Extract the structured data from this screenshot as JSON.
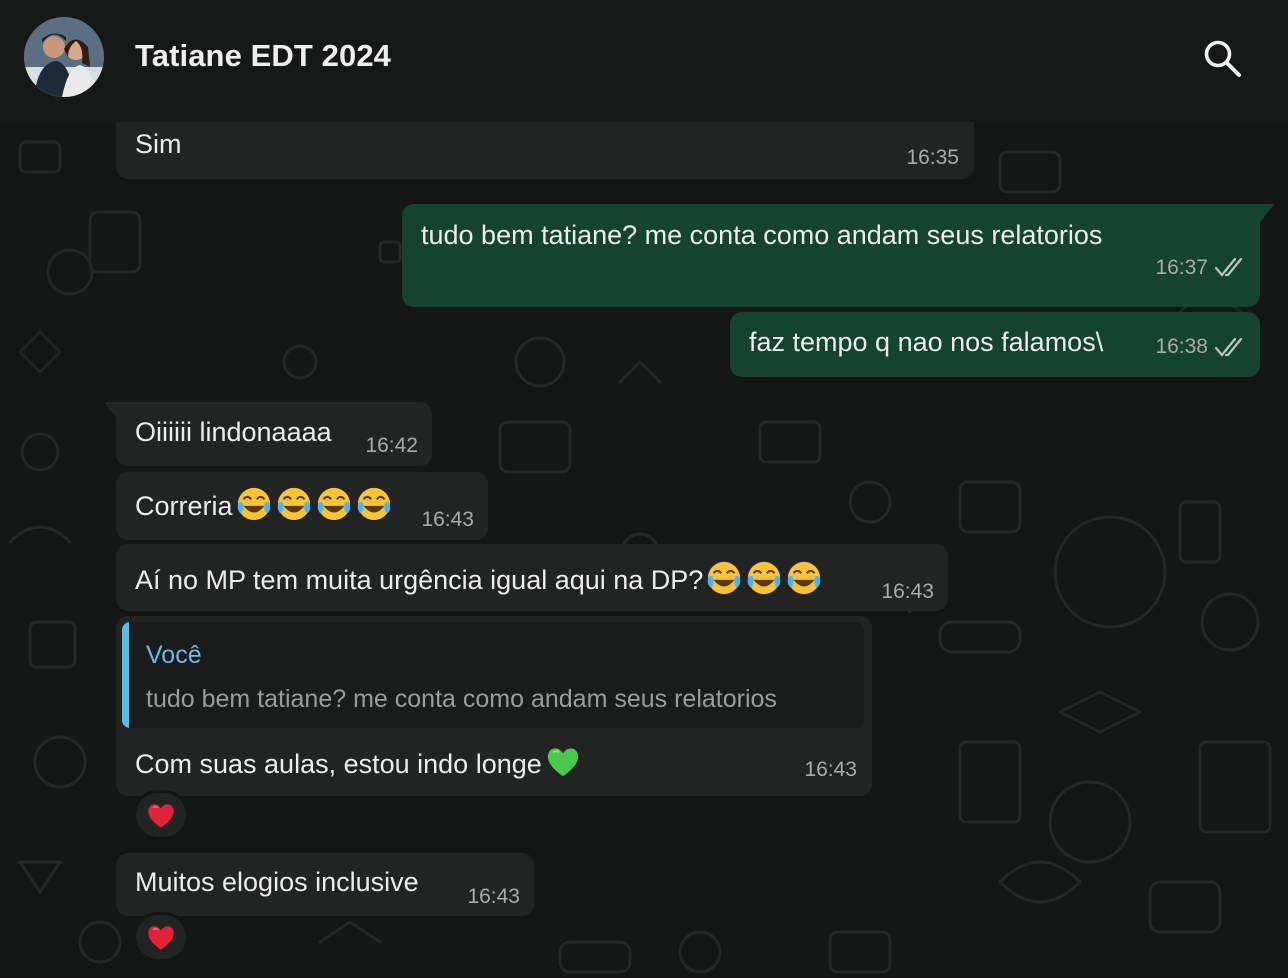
{
  "header": {
    "title": "Tatiane EDT 2024"
  },
  "colors": {
    "incoming_bubble": "#222424",
    "outgoing_bubble": "#154331",
    "quote_accent": "#53bdeb",
    "header_bg": "#161717"
  },
  "messages": [
    {
      "direction": "in",
      "text": "Sim",
      "time": "16:35"
    },
    {
      "direction": "out",
      "text": "tudo bem tatiane? me conta como andam seus relatorios",
      "time": "16:37",
      "status": "read"
    },
    {
      "direction": "out",
      "text": "faz tempo q nao nos falamos\\",
      "time": "16:38",
      "status": "read"
    },
    {
      "direction": "in",
      "text": "Oiiiiii lindonaaaa",
      "time": "16:42"
    },
    {
      "direction": "in",
      "text": "Correria",
      "emoji": "face-with-tears-of-joy x4",
      "time": "16:43"
    },
    {
      "direction": "in",
      "text": "Aí no MP tem muita urgência igual aqui na DP?",
      "emoji": "face-with-tears-of-joy x3",
      "time": "16:43"
    },
    {
      "direction": "in",
      "quote_author": "Você",
      "quote_text": "tudo bem tatiane? me conta como andam seus relatorios",
      "text": "Com suas aulas,  estou indo longe",
      "emoji": "green-heart",
      "time": "16:43",
      "reaction": "red-heart"
    },
    {
      "direction": "in",
      "text": "Muitos elogios inclusive",
      "time": "16:43",
      "reaction": "red-heart"
    }
  ]
}
